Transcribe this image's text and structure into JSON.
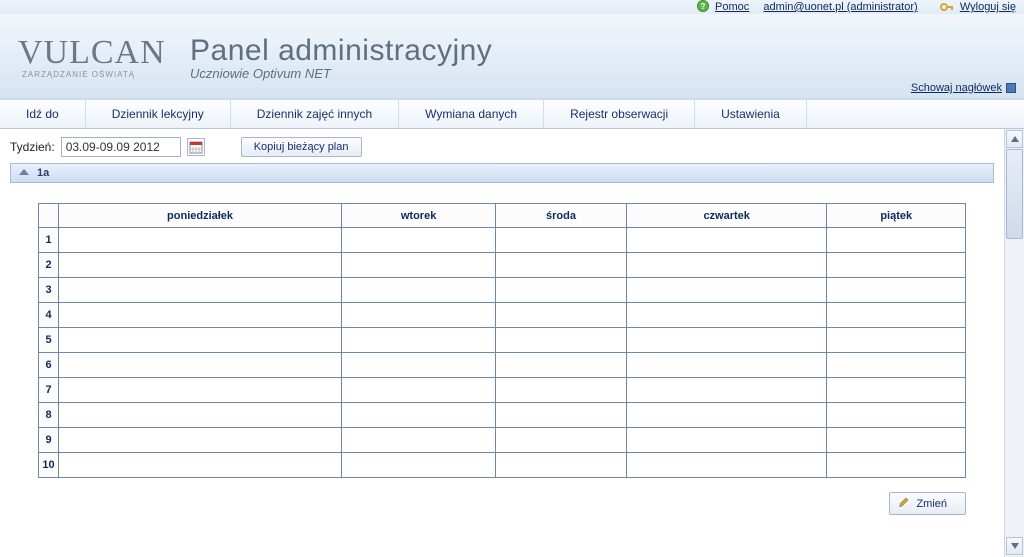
{
  "top": {
    "help_label": "Pomoc",
    "user_label": "admin@uonet.pl (administrator)",
    "logout_label": "Wyloguj się"
  },
  "header": {
    "logo_main": "VULCAN",
    "logo_sub": "ZARZĄDZANIE OŚWIATĄ",
    "title": "Panel administracyjny",
    "subtitle": "Uczniowie Optivum NET",
    "hide_label": "Schowaj nagłówek"
  },
  "menu": {
    "items": [
      "Idź do",
      "Dziennik lekcyjny",
      "Dziennik zajęć innych",
      "Wymiana danych",
      "Rejestr obserwacji",
      "Ustawienia"
    ]
  },
  "date": {
    "label": "Tydzień:",
    "value": "03.09-09.09 2012",
    "copy_label": "Kopiuj bieżący plan"
  },
  "accordion": {
    "class_label": "1a"
  },
  "table": {
    "days": [
      "poniedziałek",
      "wtorek",
      "środa",
      "czwartek",
      "piątek"
    ],
    "rows": [
      "1",
      "2",
      "3",
      "4",
      "5",
      "6",
      "7",
      "8",
      "9",
      "10"
    ]
  },
  "actions": {
    "change_label": "Zmień"
  }
}
